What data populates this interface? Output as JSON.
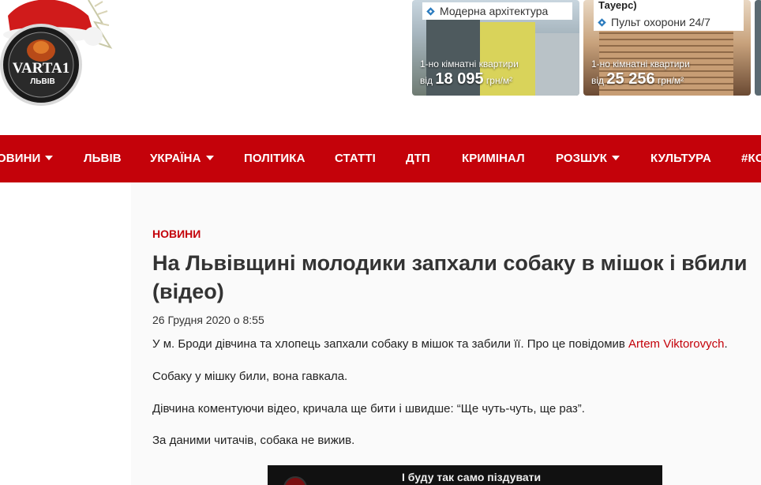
{
  "header": {
    "logo_text": "VARTA1",
    "logo_sub": "ЛЬВІВ",
    "ads": [
      {
        "tag": "Модерна архітектура",
        "subtitle": "1-но кімнатні квартири",
        "price_prefix": "від",
        "price_value": "18 095",
        "price_unit": "грн/м²"
      },
      {
        "tag_top": "Тауерс)",
        "tag": "Пульт охорони 24/7",
        "subtitle": "1-но кімнатні квартири",
        "price_prefix": "від",
        "price_value": "25 256",
        "price_unit": "грн/м²"
      }
    ]
  },
  "nav": {
    "items": [
      {
        "label": "ОВИНИ",
        "has_caret": true
      },
      {
        "label": "ЛЬВІВ",
        "has_caret": false
      },
      {
        "label": "УКРАЇНА",
        "has_caret": true
      },
      {
        "label": "ПОЛІТИКА",
        "has_caret": false
      },
      {
        "label": "СТАТТІ",
        "has_caret": false
      },
      {
        "label": "ДТП",
        "has_caret": false
      },
      {
        "label": "КРИМІНАЛ",
        "has_caret": false
      },
      {
        "label": "РОЗШУК",
        "has_caret": true
      },
      {
        "label": "КУЛЬТУРА",
        "has_caret": false
      },
      {
        "label": "#КО",
        "has_caret": false
      }
    ]
  },
  "article": {
    "category": "НОВИНИ",
    "title": "На Львівщині молодики запхали собаку в мішок і вбили (відео)",
    "date": "26 Грудня 2020 о 8:55",
    "p1_text": "У м. Броди дівчина та хлопець запхали собаку в мішок та забили її. Про це повідомив ",
    "p1_link": "Artem Viktorovych",
    "p1_end": ".",
    "p2": "Собаку у мішку били, вона гавкала.",
    "p3": "Дівчина коментуючи відео, кричала ще бити і  швидше: “Ще чуть-чуть, ще раз”.",
    "p4": "За даними читачів, собака не вижив.",
    "video_caption": "І буду так само піздувати"
  },
  "colors": {
    "brand_red": "#c4020a",
    "title_text": "#333333"
  }
}
